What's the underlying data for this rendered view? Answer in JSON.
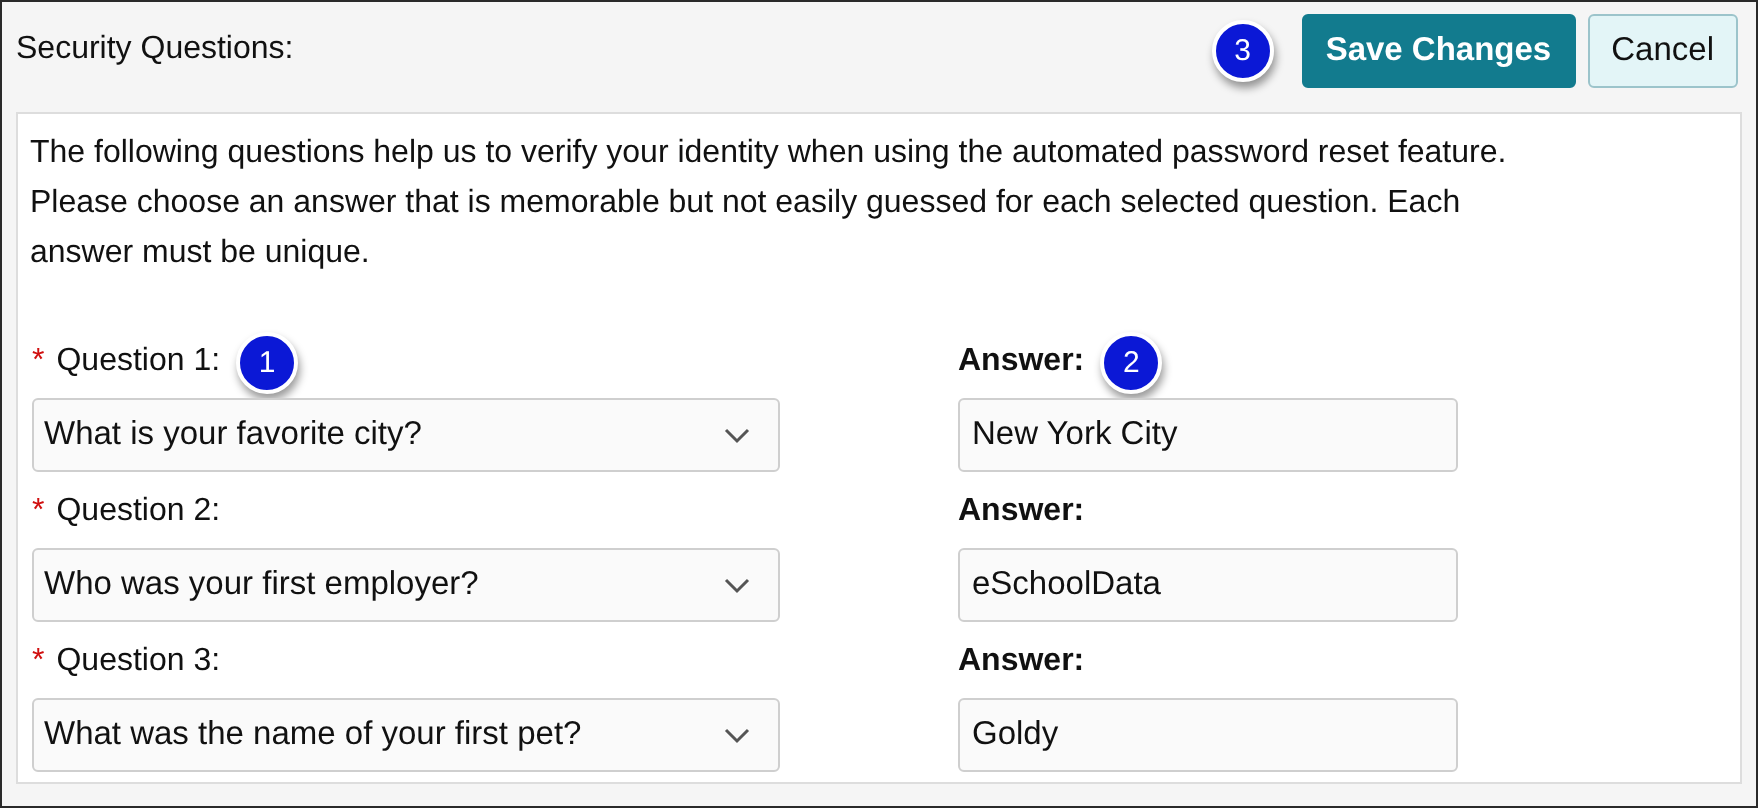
{
  "header": {
    "title": "Security Questions:",
    "callout": "3",
    "buttons": [
      {
        "kind": "primary",
        "label": "Save Changes"
      },
      {
        "kind": "secondary",
        "label": "Cancel"
      }
    ]
  },
  "description": "The following questions help us to verify your identity when using the automated password reset feature. Please choose an answer that is memorable but not easily guessed for each selected question. Each answer must be unique.",
  "required_marker": "*",
  "rows": [
    {
      "question": {
        "label": "Question 1:",
        "required": true,
        "value": "What is your favorite city?",
        "callout": "1"
      },
      "answer": {
        "label": "Answer:",
        "value": "New York City",
        "callout": "2"
      }
    },
    {
      "question": {
        "label": "Question 2:",
        "required": true,
        "value": "Who was your first employer?"
      },
      "answer": {
        "label": "Answer:",
        "value": "eSchoolData"
      }
    },
    {
      "question": {
        "label": "Question 3:",
        "required": true,
        "value": "What was the name of your first pet?"
      },
      "answer": {
        "label": "Answer:",
        "value": "Goldy"
      }
    }
  ]
}
